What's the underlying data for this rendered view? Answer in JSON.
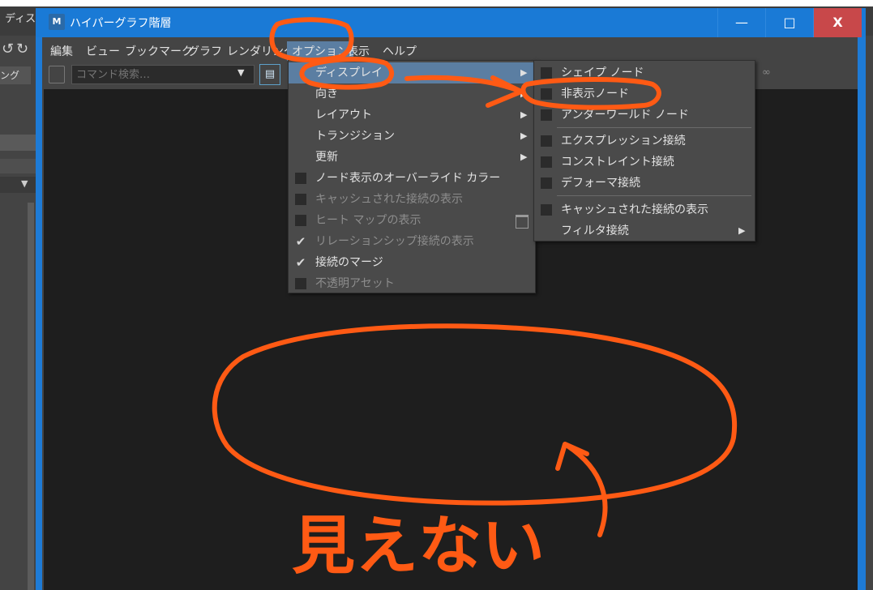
{
  "background_app": {
    "menu_label": "ディス",
    "field_label": "ング"
  },
  "window": {
    "title": "ハイパーグラフ階層",
    "icon_label": "M",
    "controls": {
      "minimize": "—",
      "maximize": "□",
      "close": "X"
    }
  },
  "menubar": {
    "items": [
      "編集",
      "ビュー",
      "ブックマーク",
      "グラフ",
      "レンダリング",
      "オプション",
      "表示",
      "ヘルプ"
    ]
  },
  "toolbar": {
    "search_placeholder": "コマンド検索…",
    "search_arrow": "▼",
    "icon_glyph": "▤",
    "right_icon_glyph": "∞"
  },
  "options_menu": {
    "items": [
      {
        "label": "ディスプレイ",
        "submenu": true,
        "highlighted": true
      },
      {
        "label": "向き",
        "submenu": true
      },
      {
        "label": "レイアウト",
        "submenu": true
      },
      {
        "label": "トランジション",
        "submenu": true
      },
      {
        "label": "更新",
        "submenu": true
      },
      {
        "label": "ノード表示のオーバーライド カラー",
        "check": "empty"
      },
      {
        "label": "キャッシュされた接続の表示",
        "check": "empty",
        "disabled": true
      },
      {
        "label": "ヒート マップの表示",
        "check": "empty",
        "disabled": true,
        "option_box": true
      },
      {
        "label": "リレーションシップ接続の表示",
        "check": "on",
        "disabled": true
      },
      {
        "label": "接続のマージ",
        "check": "on"
      },
      {
        "label": "不透明アセット",
        "check": "empty",
        "disabled": true
      }
    ]
  },
  "display_submenu": {
    "items": [
      {
        "label": "シェイプ ノード",
        "check": "empty"
      },
      {
        "label": "非表示ノード",
        "check": "empty"
      },
      {
        "label": "アンダーワールド ノード",
        "check": "empty"
      },
      {
        "label": "エクスプレッション接続",
        "check": "empty"
      },
      {
        "label": "コンストレイント接続",
        "check": "empty"
      },
      {
        "label": "デフォーマ接続",
        "check": "empty"
      },
      {
        "label": "キャッシュされた接続の表示",
        "check": "empty"
      },
      {
        "label": "フィルタ接続",
        "submenu": true
      }
    ]
  },
  "annotation": {
    "handwritten_text": "見えない",
    "color": "#ff5a14"
  },
  "glyphs": {
    "submenu_arrow": "▶",
    "check": "✔"
  }
}
